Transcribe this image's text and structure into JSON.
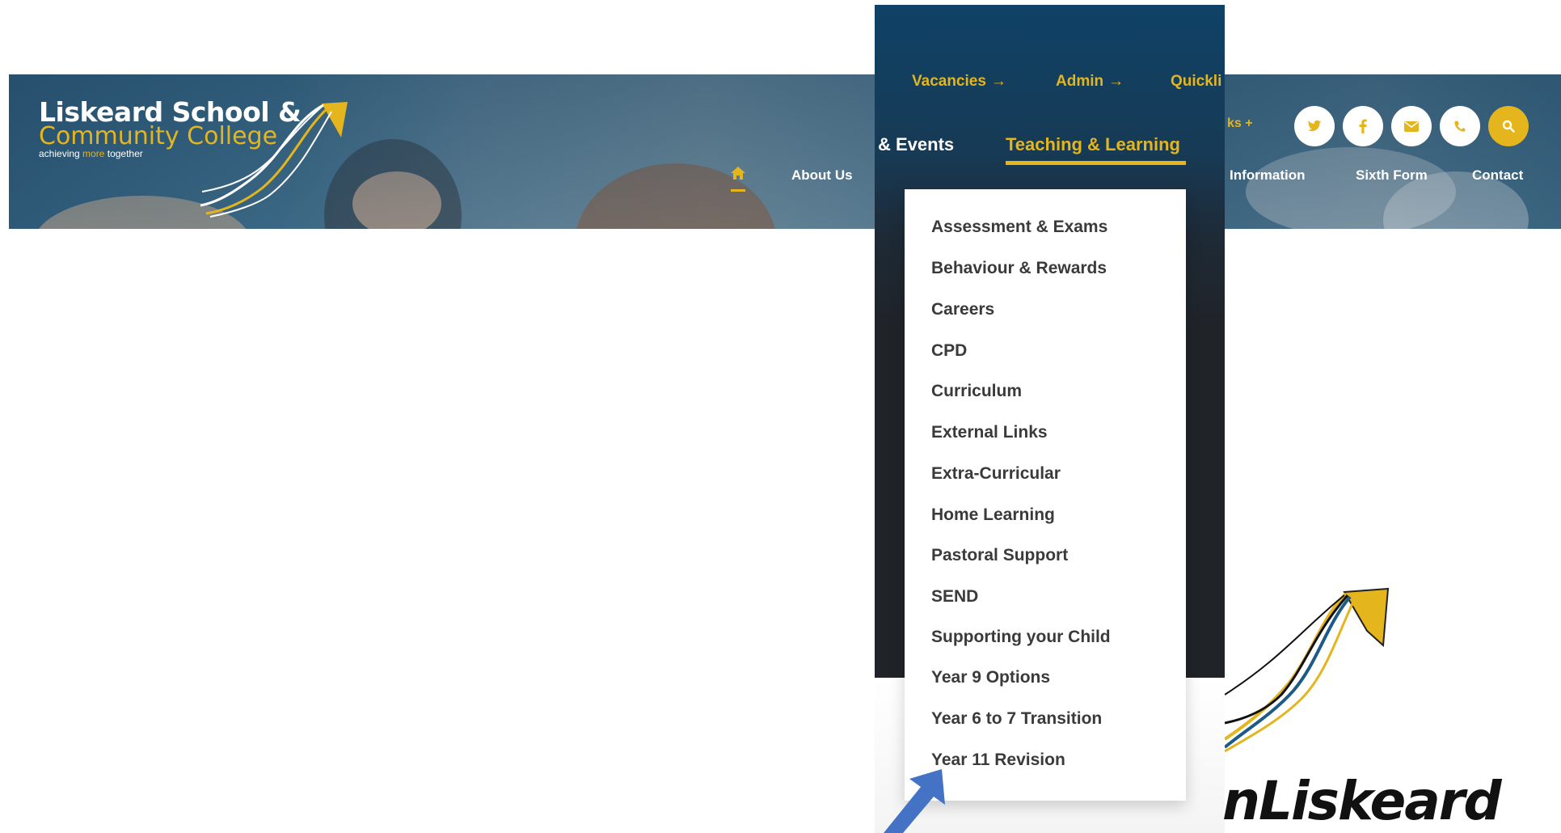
{
  "logo": {
    "line1": "Liskeard School &",
    "line2": "Community College",
    "tagline_a": "achieving",
    "tagline_more": "more",
    "tagline_b": "together"
  },
  "header_nav": {
    "about_us": "About Us",
    "information": "Information",
    "sixth_form": "Sixth Form",
    "contact": "Contact",
    "quicklinks_fragment": "ks +"
  },
  "zoom_panel": {
    "top_links": [
      {
        "label": "Vacancies",
        "arrow": "→"
      },
      {
        "label": "Admin",
        "arrow": "→"
      },
      {
        "label": "Quickli"
      }
    ],
    "tabs": {
      "partial": "& Events",
      "active": "Teaching & Learning"
    },
    "dropdown_items": [
      "Assessment & Exams",
      "Behaviour & Rewards",
      "Careers",
      "CPD",
      "Curriculum",
      "External Links",
      "Extra-Curricular",
      "Home Learning",
      "Pastoral Support",
      "SEND",
      "Supporting your Child",
      "Year 9 Options",
      "Year 6 to 7 Transition",
      "Year 11 Revision"
    ]
  },
  "footer_fragment": {
    "word": "nLiskeard"
  },
  "icons": [
    "home-icon",
    "twitter-icon",
    "facebook-icon",
    "email-icon",
    "phone-icon",
    "search-icon",
    "arrow-right-icon",
    "cursor-arrow-icon"
  ],
  "colors": {
    "brand_gold": "#e4b51d",
    "brand_navy": "#0f4266",
    "dark_panel": "#202327",
    "cursor_blue": "#4472c4"
  }
}
